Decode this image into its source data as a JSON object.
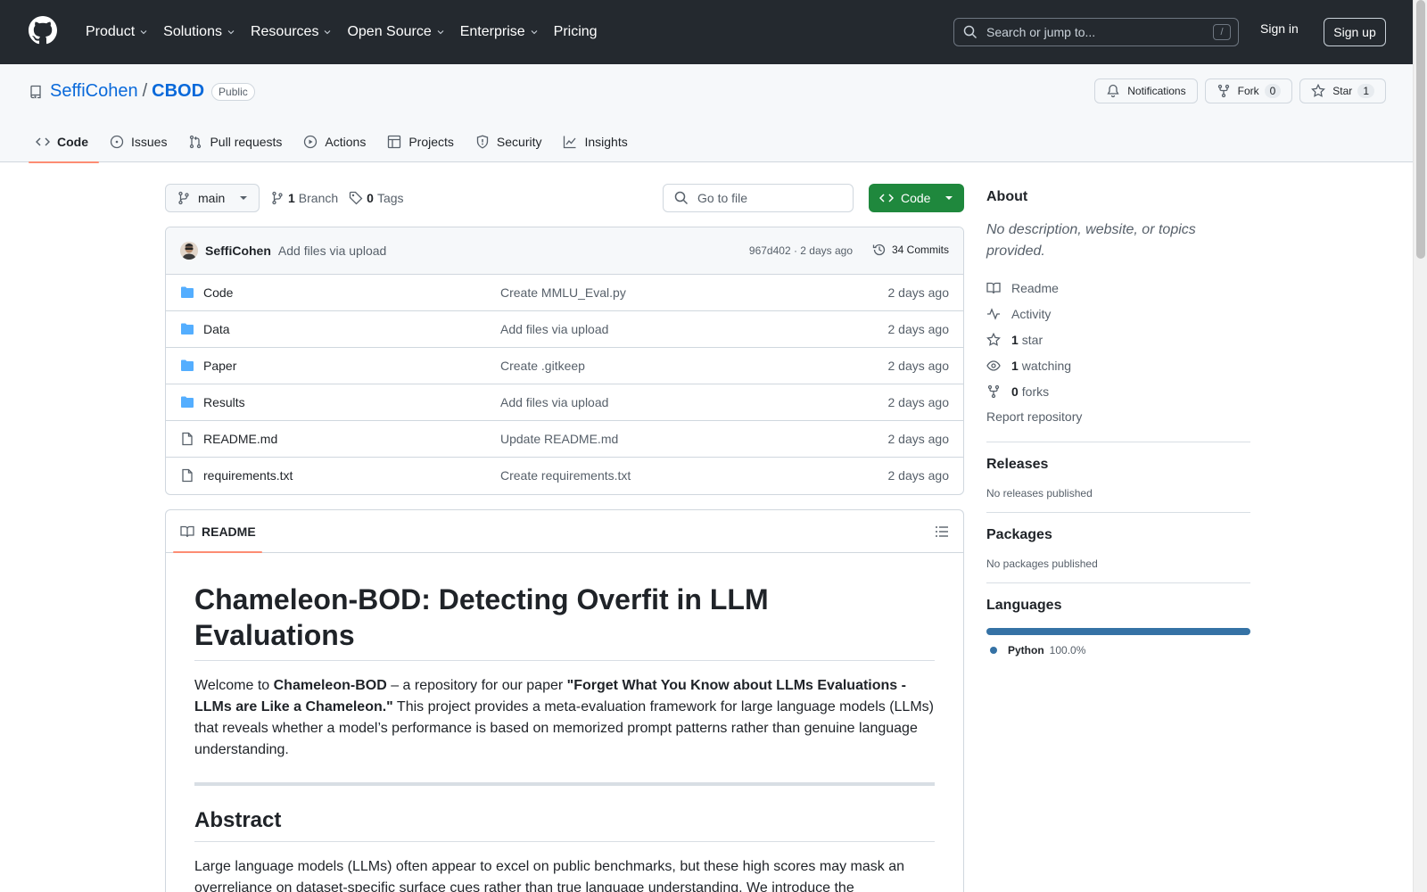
{
  "header": {
    "nav": [
      "Product",
      "Solutions",
      "Resources",
      "Open Source",
      "Enterprise",
      "Pricing"
    ],
    "search_placeholder": "Search or jump to...",
    "search_shortcut": "/",
    "sign_in": "Sign in",
    "sign_up": "Sign up"
  },
  "repo": {
    "owner": "SeffiCohen",
    "separator": "/",
    "name": "CBOD",
    "visibility": "Public",
    "notifications_label": "Notifications",
    "fork_label": "Fork",
    "fork_count": "0",
    "star_label": "Star",
    "star_count": "1",
    "tabs": [
      "Code",
      "Issues",
      "Pull requests",
      "Actions",
      "Projects",
      "Security",
      "Insights"
    ]
  },
  "toolbar": {
    "branch": "main",
    "branch_count": "1",
    "branch_word": "Branch",
    "tag_count": "0",
    "tag_word": "Tags",
    "goto_placeholder": "Go to file",
    "code_button": "Code"
  },
  "latest_commit": {
    "author": "SeffiCohen",
    "message": "Add files via upload",
    "hash_time": "967d402 · 2 days ago",
    "commits": "34 Commits"
  },
  "files": [
    {
      "name": "Code",
      "type": "dir",
      "message": "Create MMLU_Eval.py",
      "date": "2 days ago"
    },
    {
      "name": "Data",
      "type": "dir",
      "message": "Add files via upload",
      "date": "2 days ago"
    },
    {
      "name": "Paper",
      "type": "dir",
      "message": "Create .gitkeep",
      "date": "2 days ago"
    },
    {
      "name": "Results",
      "type": "dir",
      "message": "Add files via upload",
      "date": "2 days ago"
    },
    {
      "name": "README.md",
      "type": "file",
      "message": "Update README.md",
      "date": "2 days ago"
    },
    {
      "name": "requirements.txt",
      "type": "file",
      "message": "Create requirements.txt",
      "date": "2 days ago"
    }
  ],
  "readme": {
    "tab_label": "README",
    "title": "Chameleon-BOD: Detecting Overfit in LLM Evaluations",
    "intro_1": "Welcome to ",
    "intro_bold_1": "Chameleon-BOD",
    "intro_2": " – a repository for our paper ",
    "intro_bold_2": "\"Forget What You Know about LLMs Evaluations - LLMs are Like a Chameleon.\"",
    "intro_3": " This project provides a meta-evaluation framework for large language models (LLMs) that reveals whether a model’s performance is based on memorized prompt patterns rather than genuine language understanding.",
    "abstract_heading": "Abstract",
    "abstract_text": "Large language models (LLMs) often appear to excel on public benchmarks, but these high scores may mask an overreliance on dataset-specific surface cues rather than true language understanding. We introduce the"
  },
  "sidebar": {
    "about_heading": "About",
    "description": "No description, website, or topics provided.",
    "readme": "Readme",
    "activity": "Activity",
    "stars_count": "1",
    "stars_word": "star",
    "watching_count": "1",
    "watching_word": "watching",
    "forks_count": "0",
    "forks_word": "forks",
    "report": "Report repository",
    "releases_heading": "Releases",
    "releases_text": "No releases published",
    "packages_heading": "Packages",
    "packages_text": "No packages published",
    "languages_heading": "Languages",
    "language_name": "Python",
    "language_pct": "100.0%",
    "language_color": "#3572a5"
  }
}
